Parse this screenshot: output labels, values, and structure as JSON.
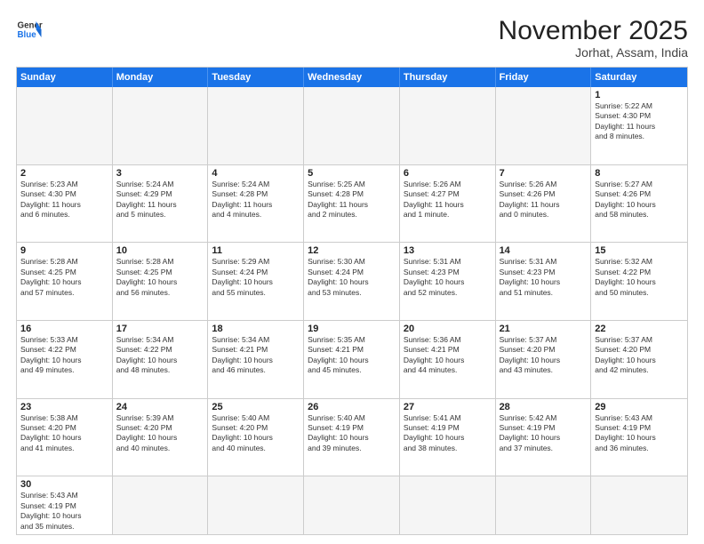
{
  "header": {
    "logo_line1": "General",
    "logo_line2": "Blue",
    "month": "November 2025",
    "location": "Jorhat, Assam, India"
  },
  "weekdays": [
    "Sunday",
    "Monday",
    "Tuesday",
    "Wednesday",
    "Thursday",
    "Friday",
    "Saturday"
  ],
  "rows": [
    [
      {
        "day": "",
        "info": ""
      },
      {
        "day": "",
        "info": ""
      },
      {
        "day": "",
        "info": ""
      },
      {
        "day": "",
        "info": ""
      },
      {
        "day": "",
        "info": ""
      },
      {
        "day": "",
        "info": ""
      },
      {
        "day": "1",
        "info": "Sunrise: 5:22 AM\nSunset: 4:30 PM\nDaylight: 11 hours\nand 8 minutes."
      }
    ],
    [
      {
        "day": "2",
        "info": "Sunrise: 5:23 AM\nSunset: 4:30 PM\nDaylight: 11 hours\nand 6 minutes."
      },
      {
        "day": "3",
        "info": "Sunrise: 5:24 AM\nSunset: 4:29 PM\nDaylight: 11 hours\nand 5 minutes."
      },
      {
        "day": "4",
        "info": "Sunrise: 5:24 AM\nSunset: 4:28 PM\nDaylight: 11 hours\nand 4 minutes."
      },
      {
        "day": "5",
        "info": "Sunrise: 5:25 AM\nSunset: 4:28 PM\nDaylight: 11 hours\nand 2 minutes."
      },
      {
        "day": "6",
        "info": "Sunrise: 5:26 AM\nSunset: 4:27 PM\nDaylight: 11 hours\nand 1 minute."
      },
      {
        "day": "7",
        "info": "Sunrise: 5:26 AM\nSunset: 4:26 PM\nDaylight: 11 hours\nand 0 minutes."
      },
      {
        "day": "8",
        "info": "Sunrise: 5:27 AM\nSunset: 4:26 PM\nDaylight: 10 hours\nand 58 minutes."
      }
    ],
    [
      {
        "day": "9",
        "info": "Sunrise: 5:28 AM\nSunset: 4:25 PM\nDaylight: 10 hours\nand 57 minutes."
      },
      {
        "day": "10",
        "info": "Sunrise: 5:28 AM\nSunset: 4:25 PM\nDaylight: 10 hours\nand 56 minutes."
      },
      {
        "day": "11",
        "info": "Sunrise: 5:29 AM\nSunset: 4:24 PM\nDaylight: 10 hours\nand 55 minutes."
      },
      {
        "day": "12",
        "info": "Sunrise: 5:30 AM\nSunset: 4:24 PM\nDaylight: 10 hours\nand 53 minutes."
      },
      {
        "day": "13",
        "info": "Sunrise: 5:31 AM\nSunset: 4:23 PM\nDaylight: 10 hours\nand 52 minutes."
      },
      {
        "day": "14",
        "info": "Sunrise: 5:31 AM\nSunset: 4:23 PM\nDaylight: 10 hours\nand 51 minutes."
      },
      {
        "day": "15",
        "info": "Sunrise: 5:32 AM\nSunset: 4:22 PM\nDaylight: 10 hours\nand 50 minutes."
      }
    ],
    [
      {
        "day": "16",
        "info": "Sunrise: 5:33 AM\nSunset: 4:22 PM\nDaylight: 10 hours\nand 49 minutes."
      },
      {
        "day": "17",
        "info": "Sunrise: 5:34 AM\nSunset: 4:22 PM\nDaylight: 10 hours\nand 48 minutes."
      },
      {
        "day": "18",
        "info": "Sunrise: 5:34 AM\nSunset: 4:21 PM\nDaylight: 10 hours\nand 46 minutes."
      },
      {
        "day": "19",
        "info": "Sunrise: 5:35 AM\nSunset: 4:21 PM\nDaylight: 10 hours\nand 45 minutes."
      },
      {
        "day": "20",
        "info": "Sunrise: 5:36 AM\nSunset: 4:21 PM\nDaylight: 10 hours\nand 44 minutes."
      },
      {
        "day": "21",
        "info": "Sunrise: 5:37 AM\nSunset: 4:20 PM\nDaylight: 10 hours\nand 43 minutes."
      },
      {
        "day": "22",
        "info": "Sunrise: 5:37 AM\nSunset: 4:20 PM\nDaylight: 10 hours\nand 42 minutes."
      }
    ],
    [
      {
        "day": "23",
        "info": "Sunrise: 5:38 AM\nSunset: 4:20 PM\nDaylight: 10 hours\nand 41 minutes."
      },
      {
        "day": "24",
        "info": "Sunrise: 5:39 AM\nSunset: 4:20 PM\nDaylight: 10 hours\nand 40 minutes."
      },
      {
        "day": "25",
        "info": "Sunrise: 5:40 AM\nSunset: 4:20 PM\nDaylight: 10 hours\nand 40 minutes."
      },
      {
        "day": "26",
        "info": "Sunrise: 5:40 AM\nSunset: 4:19 PM\nDaylight: 10 hours\nand 39 minutes."
      },
      {
        "day": "27",
        "info": "Sunrise: 5:41 AM\nSunset: 4:19 PM\nDaylight: 10 hours\nand 38 minutes."
      },
      {
        "day": "28",
        "info": "Sunrise: 5:42 AM\nSunset: 4:19 PM\nDaylight: 10 hours\nand 37 minutes."
      },
      {
        "day": "29",
        "info": "Sunrise: 5:43 AM\nSunset: 4:19 PM\nDaylight: 10 hours\nand 36 minutes."
      }
    ],
    [
      {
        "day": "30",
        "info": "Sunrise: 5:43 AM\nSunset: 4:19 PM\nDaylight: 10 hours\nand 35 minutes."
      },
      {
        "day": "",
        "info": ""
      },
      {
        "day": "",
        "info": ""
      },
      {
        "day": "",
        "info": ""
      },
      {
        "day": "",
        "info": ""
      },
      {
        "day": "",
        "info": ""
      },
      {
        "day": "",
        "info": ""
      }
    ]
  ]
}
